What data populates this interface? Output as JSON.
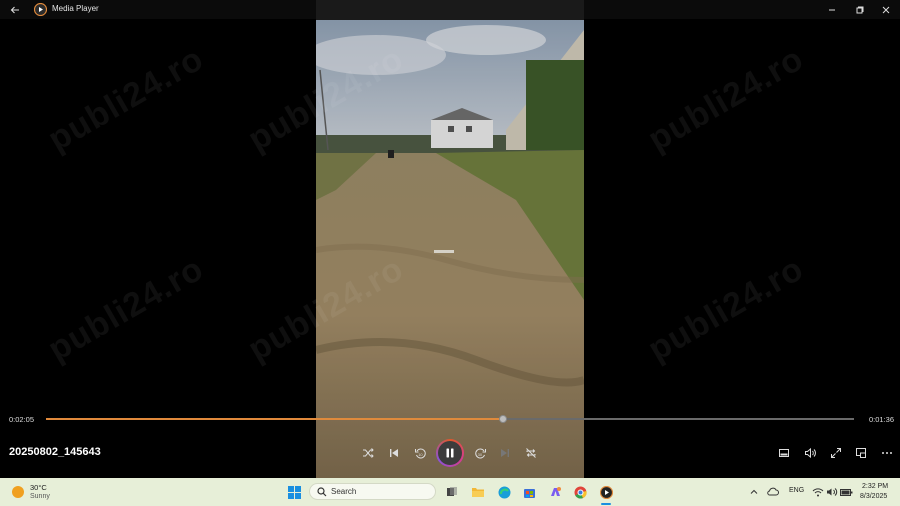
{
  "app": {
    "title": "Media Player",
    "colors": {
      "accent": "#e08a3c",
      "background": "#000000"
    }
  },
  "titlebar": {
    "back_icon": "back-arrow-icon",
    "app_icon": "media-player-icon",
    "minimize_icon": "minimize-icon",
    "maximize_icon": "restore-icon",
    "close_icon": "close-icon"
  },
  "watermark": {
    "text": "publi24.ro"
  },
  "player": {
    "elapsed": "0:02:05",
    "remaining": "0:01:36",
    "progress_fraction": 0.566,
    "file_name": "20250802_145643",
    "controls": {
      "shuffle_icon": "shuffle-icon",
      "previous_icon": "previous-track-icon",
      "rewind_icon": "skip-back-10-icon",
      "play_pause_icon": "pause-icon",
      "forward_icon": "skip-forward-30-icon",
      "next_icon": "next-track-icon",
      "repeat_icon": "repeat-off-icon"
    },
    "right_controls": {
      "miniplayer_icon": "miniplayer-icon",
      "volume_icon": "volume-icon",
      "fullscreen_icon": "fullscreen-icon",
      "cast_icon": "cast-icon",
      "more_icon": "more-options-icon"
    }
  },
  "taskbar": {
    "weather": {
      "temperature": "30°C",
      "condition": "Sunny"
    },
    "search_label": "Search",
    "pinned_apps": [
      "windows-start-icon",
      "search-icon",
      "task-view-icon",
      "file-explorer-icon",
      "edge-icon",
      "microsoft-store-icon",
      "copilot-icon",
      "chrome-icon",
      "media-player-icon"
    ],
    "tray": {
      "language": "ENG",
      "time": "2:32 PM",
      "date": "8/3/2025"
    }
  }
}
